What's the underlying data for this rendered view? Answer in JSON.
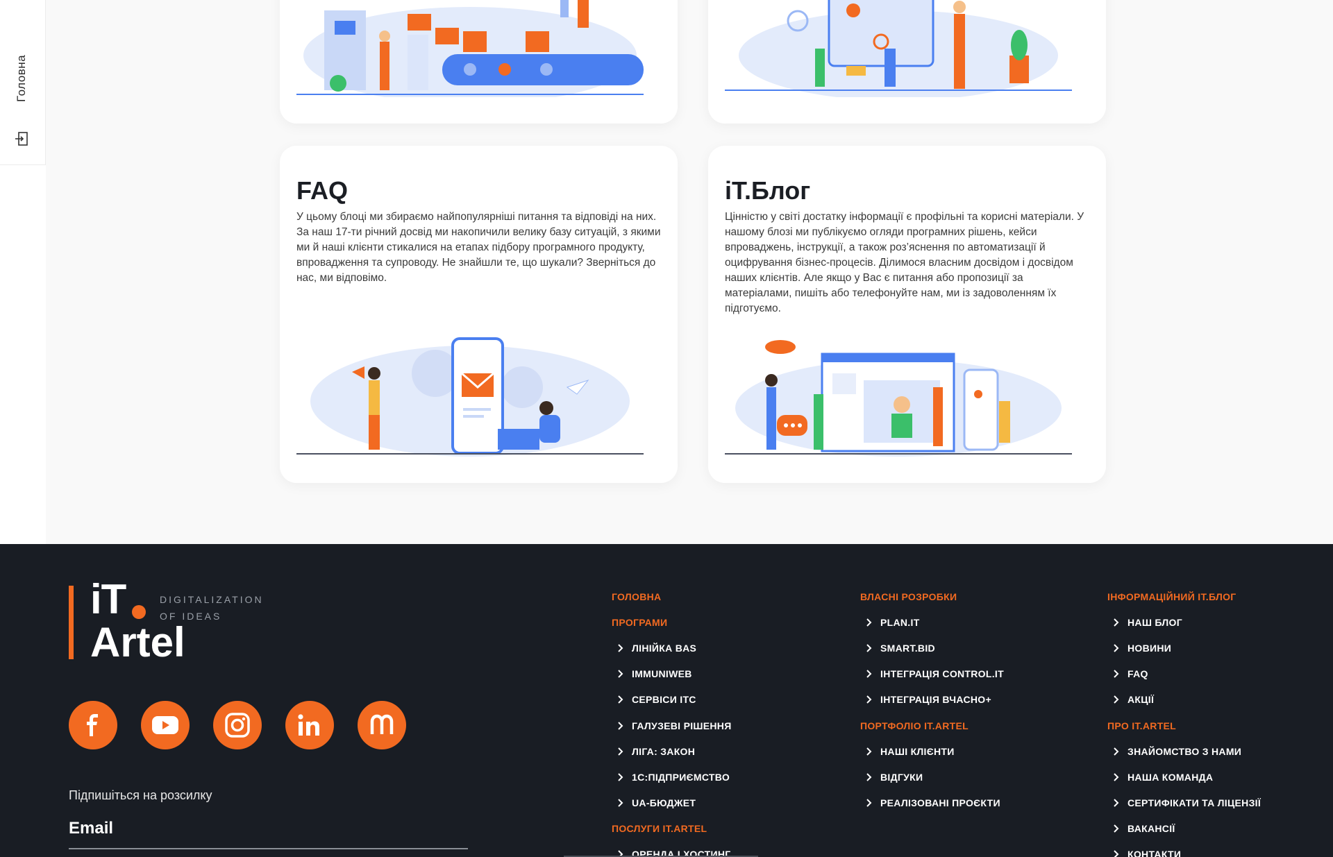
{
  "side_nav": {
    "home_label": "Головна"
  },
  "cards": {
    "faq": {
      "title": "FAQ",
      "text": "У цьому блоці ми збираємо найпопулярніші питання та відповіді на них. За наш 17-ти річний досвід ми накопичили велику базу ситуацій, з якими ми й наші клієнти стикалися на етапах підбору програмного продукту, впровадження та супроводу. Не знайшли те, що шукали? Зверніться до нас, ми відповімо."
    },
    "blog": {
      "title": "iT.Блог",
      "text": "Цінністю у світі достатку інформації є профільні та корисні матеріали. У нашому блозі ми публікуємо огляди програмних рішень, кейси впроваджень, інструкції, а також роз’яснення по автоматизації й оцифрування бізнес-процесів. Ділимося власним досвідом і досвідом наших клієнтів. Але якщо у Вас є питання або пропозиції за матеріалами, пишіть або телефонуйте нам, ми із задоволенням їх підготуємо."
    }
  },
  "footer": {
    "logo": {
      "it": "iT",
      "artel": "Artel",
      "tagline_1": "DIGITALIZATION",
      "tagline_2": "OF IDEAS"
    },
    "socials": [
      "facebook-icon",
      "youtube-icon",
      "instagram-icon",
      "linkedin-icon",
      "megogo-icon"
    ],
    "subscribe_label": "Підпишіться на розсилку",
    "email_label": "Email",
    "columns": [
      [
        {
          "type": "head",
          "label": "ГОЛОВНА"
        },
        {
          "type": "head",
          "label": "ПРОГРАМИ"
        },
        {
          "type": "link",
          "label": "ЛІНІЙКА BAS"
        },
        {
          "type": "link",
          "label": "IMMUNIWEB"
        },
        {
          "type": "link",
          "label": "СЕРВІСИ ІТС"
        },
        {
          "type": "link",
          "label": "ГАЛУЗЕВІ РІШЕННЯ"
        },
        {
          "type": "link",
          "label": "ЛІГА: ЗАКОН"
        },
        {
          "type": "link",
          "label": "1С:ПІДПРИЄМСТВО"
        },
        {
          "type": "link",
          "label": "UA-БЮДЖЕТ"
        },
        {
          "type": "head",
          "label": "ПОСЛУГИ IT.ARTEL"
        },
        {
          "type": "link",
          "label": "ОРЕНДА І ХОСТИНГ"
        }
      ],
      [
        {
          "type": "head",
          "label": "ВЛАСНІ РОЗРОБКИ"
        },
        {
          "type": "link",
          "label": "PLAN.IT"
        },
        {
          "type": "link",
          "label": "SMART.BID"
        },
        {
          "type": "link",
          "label": "ІНТЕГРАЦІЯ CONTROL.IT"
        },
        {
          "type": "link",
          "label": "ІНТЕГРАЦІЯ ВЧАСНО+"
        },
        {
          "type": "head",
          "label": "ПОРТФОЛІО IT.ARTEL"
        },
        {
          "type": "link",
          "label": "НАШІ КЛІЄНТИ"
        },
        {
          "type": "link",
          "label": "ВІДГУКИ"
        },
        {
          "type": "link",
          "label": "РЕАЛІЗОВАНІ ПРОЄКТИ"
        }
      ],
      [
        {
          "type": "head",
          "label": "ІНФОРМАЦІЙНИЙ IT.БЛОГ"
        },
        {
          "type": "link",
          "label": "НАШ БЛОГ"
        },
        {
          "type": "link",
          "label": "НОВИНИ"
        },
        {
          "type": "link",
          "label": "FAQ"
        },
        {
          "type": "link",
          "label": "АКЦІЇ"
        },
        {
          "type": "head",
          "label": "ПРО IT.ARTEL"
        },
        {
          "type": "link",
          "label": "ЗНАЙОМСТВО З НАМИ"
        },
        {
          "type": "link",
          "label": "НАША КОМАНДА"
        },
        {
          "type": "link",
          "label": "СЕРТИФІКАТИ ТА ЛІЦЕНЗІЇ"
        },
        {
          "type": "link",
          "label": "ВАКАНСІЇ"
        },
        {
          "type": "link",
          "label": "КОНТАКТИ"
        }
      ]
    ]
  },
  "colors": {
    "accent": "#f26a21",
    "footer_bg": "#191d24",
    "illustration_blue": "#4a7ff0",
    "illustration_light": "#dce6fb"
  }
}
